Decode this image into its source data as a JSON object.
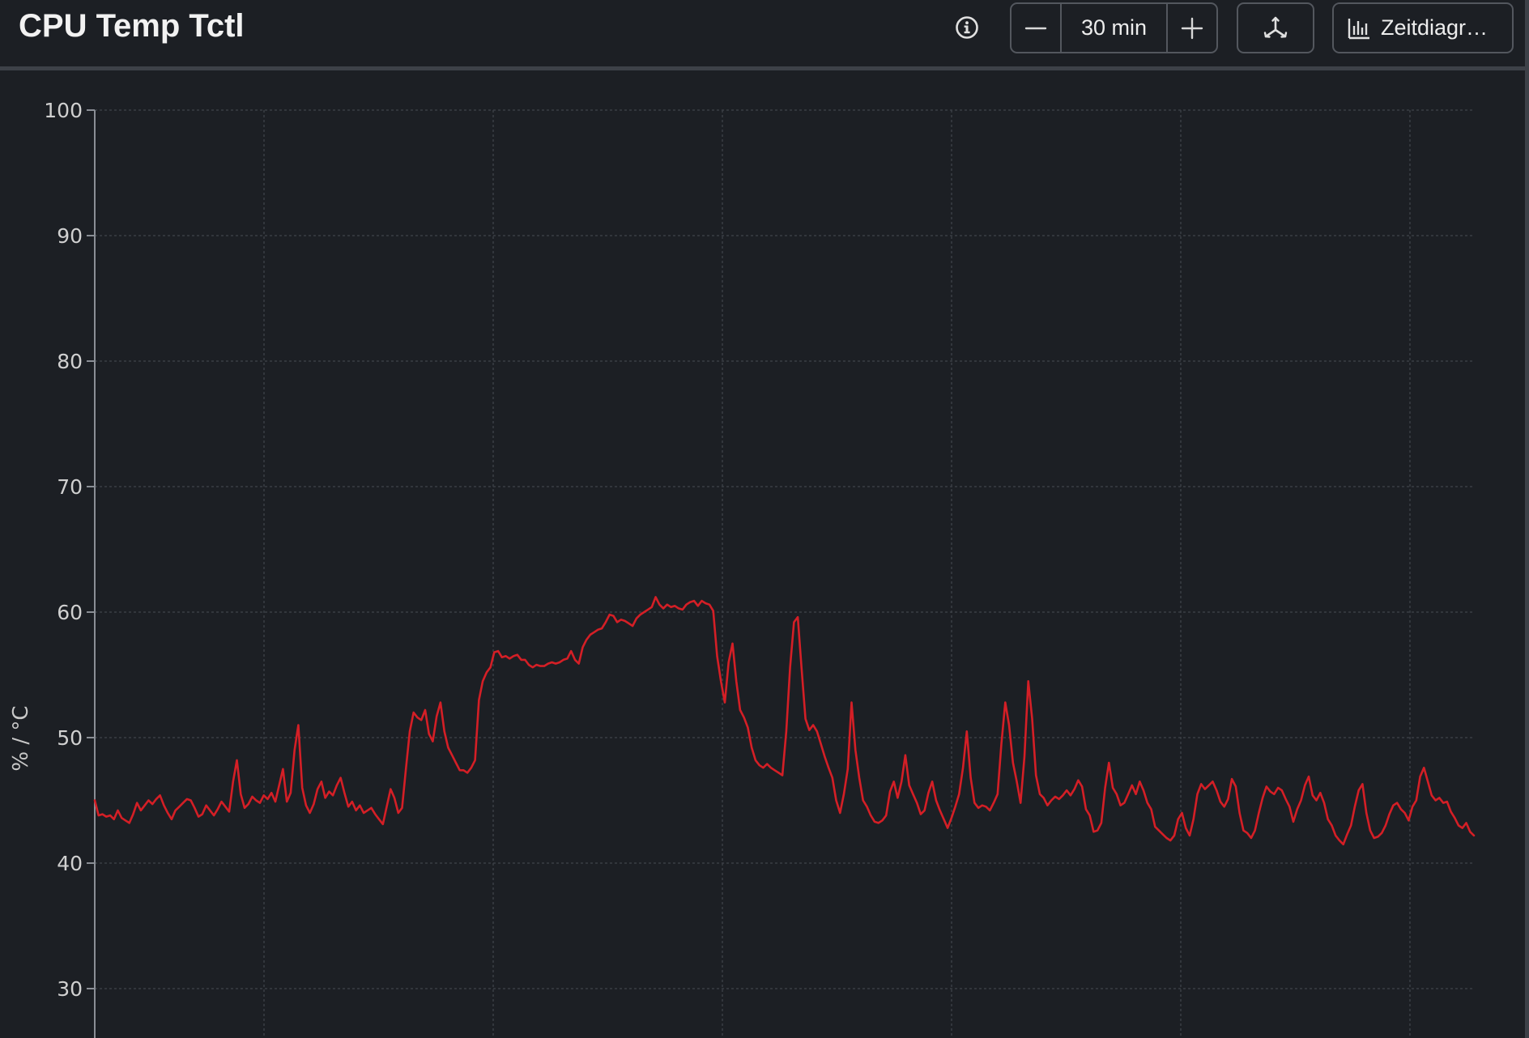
{
  "header": {
    "title": "CPU Temp Tctl",
    "info_icon": "info-circle-icon",
    "time_window": "30 min",
    "decrease_icon": "minus-icon",
    "increase_icon": "plus-icon",
    "axes_icon": "axes-icon",
    "chart_type_icon": "bar-chart-icon",
    "chart_type_label": "Zeitdiagr…"
  },
  "colors": {
    "background": "#1c1f24",
    "series": "#d41f26",
    "grid": "#3a3e45",
    "axis": "#8a8e95"
  },
  "chart_data": {
    "type": "line",
    "ylabel": "% / °C",
    "ylim": [
      26.5,
      100
    ],
    "yticks": [
      30,
      40,
      50,
      60,
      70,
      80,
      90,
      100
    ],
    "x_gridlines": 6,
    "grid": true,
    "series": [
      {
        "values": [
          45.0,
          43.8,
          43.9,
          43.7,
          43.8,
          43.5,
          44.2,
          43.6,
          43.4,
          43.2,
          43.9,
          44.8,
          44.2,
          44.6,
          45.0,
          44.7,
          45.1,
          45.4,
          44.6,
          44.0,
          43.5,
          44.2,
          44.5,
          44.8,
          45.1,
          45.0,
          44.4,
          43.7,
          43.9,
          44.6,
          44.2,
          43.8,
          44.3,
          44.9,
          44.5,
          44.1,
          46.5,
          48.2,
          45.5,
          44.4,
          44.7,
          45.3,
          45.0,
          44.8,
          45.4,
          45.1,
          45.6,
          44.9,
          46.2,
          47.5,
          44.9,
          45.6,
          49.0,
          51.0,
          46.0,
          44.6,
          44.0,
          44.7,
          45.9,
          46.5,
          45.2,
          45.7,
          45.4,
          46.2,
          46.8,
          45.6,
          44.5,
          44.9,
          44.2,
          44.6,
          44.0,
          44.2,
          44.4,
          43.9,
          43.5,
          43.1,
          44.5,
          45.9,
          45.2,
          44.0,
          44.4,
          47.5,
          50.5,
          52.0,
          51.6,
          51.4,
          52.2,
          50.3,
          49.7,
          51.7,
          52.8,
          50.5,
          49.2,
          48.6,
          48.0,
          47.4,
          47.4,
          47.2,
          47.6,
          48.2,
          53.0,
          54.5,
          55.2,
          55.6,
          56.8,
          56.9,
          56.4,
          56.5,
          56.3,
          56.5,
          56.6,
          56.2,
          56.2,
          55.8,
          55.6,
          55.8,
          55.7,
          55.7,
          55.9,
          56.0,
          55.9,
          56.0,
          56.2,
          56.3,
          56.9,
          56.2,
          55.9,
          57.2,
          57.8,
          58.2,
          58.4,
          58.6,
          58.7,
          59.2,
          59.8,
          59.7,
          59.2,
          59.4,
          59.3,
          59.1,
          58.9,
          59.5,
          59.8,
          60.0,
          60.2,
          60.4,
          61.2,
          60.6,
          60.3,
          60.6,
          60.4,
          60.5,
          60.3,
          60.2,
          60.6,
          60.8,
          60.9,
          60.5,
          60.9,
          60.7,
          60.6,
          60.1,
          56.5,
          54.5,
          52.8,
          56.0,
          57.5,
          54.5,
          52.2,
          51.6,
          50.8,
          49.2,
          48.2,
          47.8,
          47.6,
          47.9,
          47.6,
          47.4,
          47.2,
          47.0,
          50.5,
          55.6,
          59.2,
          59.6,
          55.5,
          51.5,
          50.6,
          51.0,
          50.5,
          49.5,
          48.5,
          47.6,
          46.8,
          45.0,
          44.0,
          45.5,
          47.5,
          52.8,
          49.0,
          46.8,
          45.0,
          44.5,
          43.8,
          43.3,
          43.2,
          43.4,
          43.8,
          45.7,
          46.5,
          45.2,
          46.5,
          48.6,
          46.2,
          45.5,
          44.8,
          43.9,
          44.2,
          45.6,
          46.5,
          45.0,
          44.2,
          43.5,
          42.8,
          43.6,
          44.5,
          45.5,
          47.6,
          50.5,
          46.8,
          44.8,
          44.4,
          44.6,
          44.5,
          44.2,
          44.8,
          45.5,
          49.5,
          52.8,
          51.0,
          48.0,
          46.5,
          44.8,
          48.5,
          54.5,
          51.5,
          47.0,
          45.5,
          45.2,
          44.6,
          45.0,
          45.3,
          45.1,
          45.4,
          45.8,
          45.4,
          45.9,
          46.6,
          46.1,
          44.3,
          43.8,
          42.5,
          42.6,
          43.2,
          46.0,
          48.0,
          46.0,
          45.5,
          44.6,
          44.8,
          45.5,
          46.2,
          45.5,
          46.5,
          45.8,
          44.8,
          44.3,
          42.9,
          42.6,
          42.3,
          42.0,
          41.8,
          42.2,
          43.5,
          44.0,
          42.8,
          42.2,
          43.5,
          45.5,
          46.3,
          45.9,
          46.2,
          46.5,
          45.8,
          44.9,
          44.5,
          45.1,
          46.7,
          46.1,
          44.0,
          42.6,
          42.4,
          42.0,
          42.6,
          44.0,
          45.2,
          46.1,
          45.7,
          45.5,
          46.0,
          45.8,
          45.1,
          44.5,
          43.3,
          44.3,
          45.0,
          46.2,
          46.9,
          45.4,
          45.0,
          45.6,
          44.8,
          43.5,
          43.0,
          42.2,
          41.8,
          41.5,
          42.3,
          43.0,
          44.5,
          45.8,
          46.3,
          44.0,
          42.6,
          42.0,
          42.1,
          42.4,
          43.0,
          43.9,
          44.6,
          44.8,
          44.3,
          44.0,
          43.4,
          44.5,
          45.0,
          46.9,
          47.6,
          46.5,
          45.4,
          45.0,
          45.2,
          44.8,
          44.9,
          44.1,
          43.6,
          43.0,
          42.8,
          43.2,
          42.5,
          42.2
        ]
      }
    ]
  }
}
